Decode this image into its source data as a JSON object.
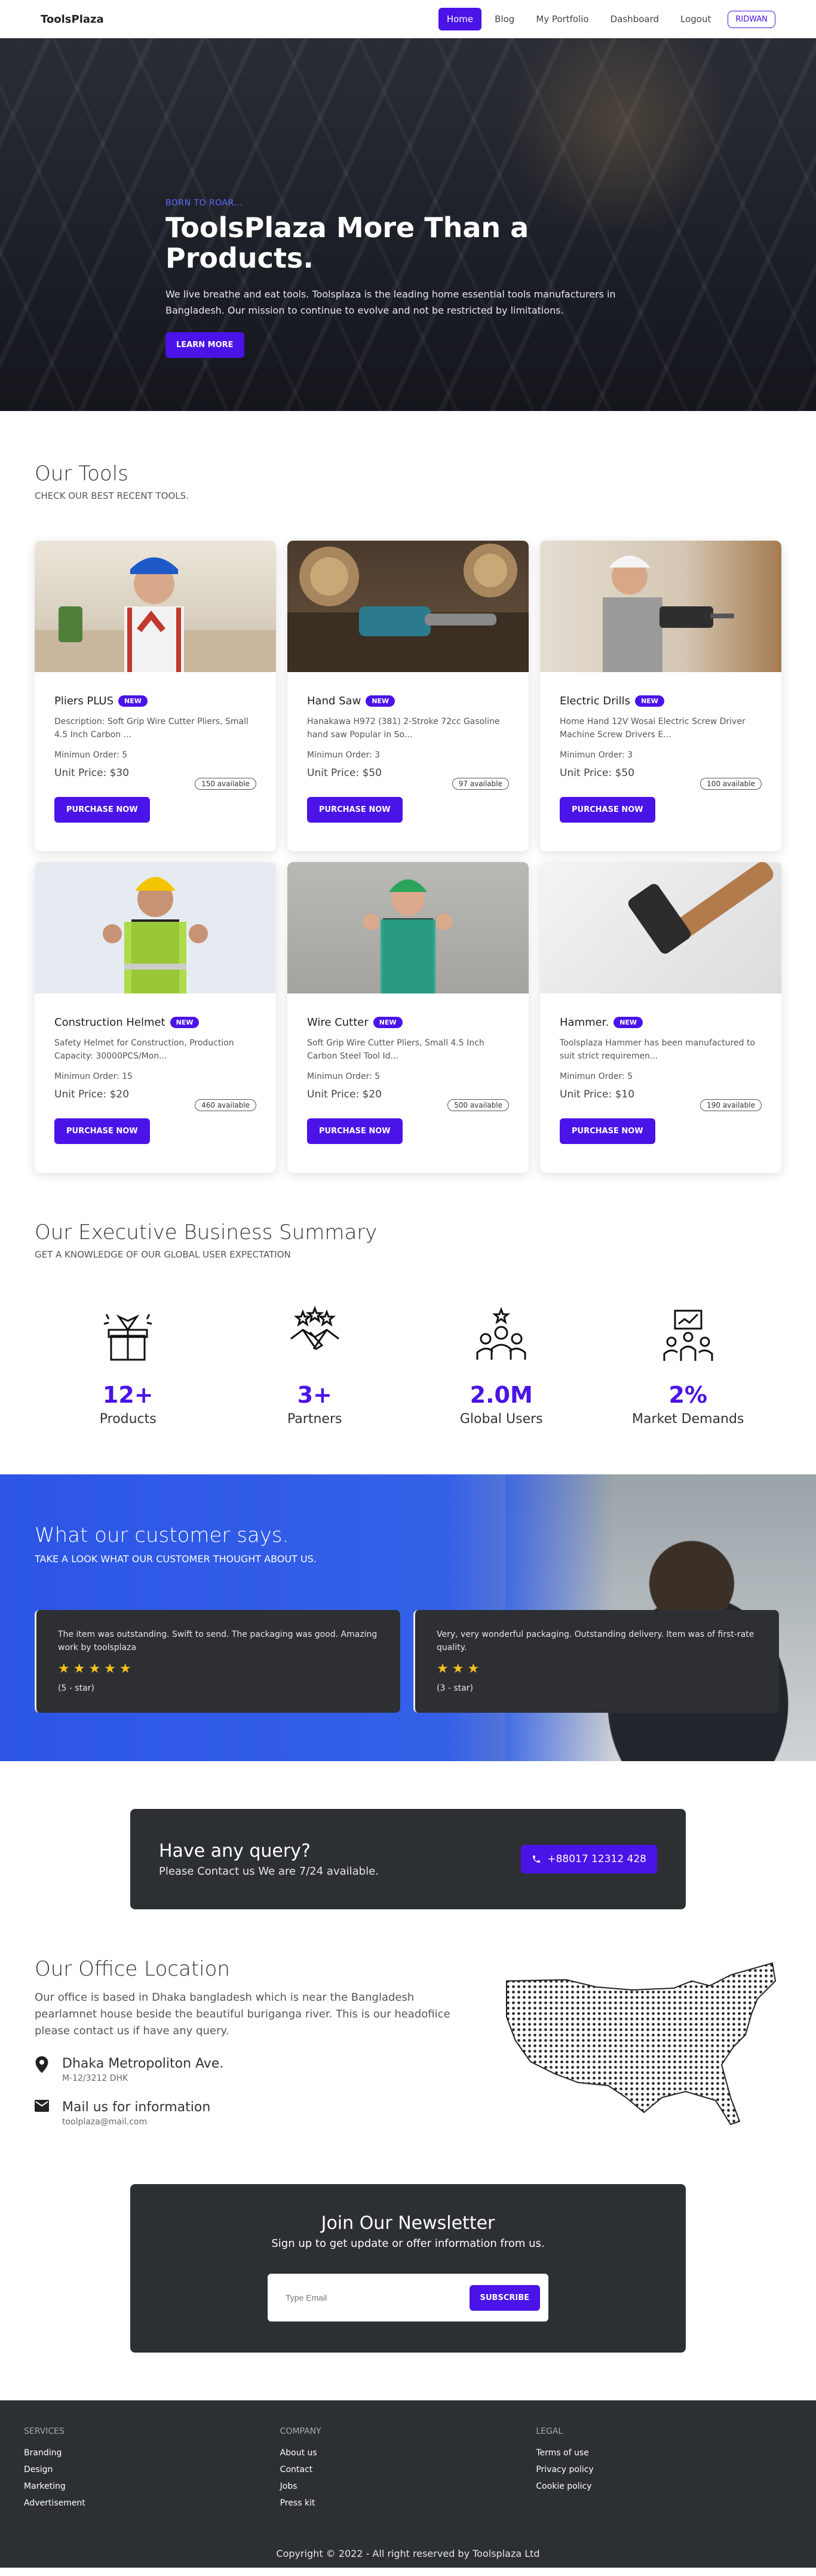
{
  "nav": {
    "brand": "ToolsPlaza",
    "links": [
      "Home",
      "Blog",
      "My Portfolio",
      "Dashboard",
      "Logout"
    ],
    "user": "RIDWAN",
    "accent": "#4a13e7"
  },
  "hero": {
    "kicker": "BORN TO ROAR...",
    "title": "ToolsPlaza More Than a Products.",
    "text": "We live breathe and eat tools. Toolsplaza is the leading home essential tools manufacturers in Bangladesh. Our mission to continue to evolve and not be restricted by limitations.",
    "button": "LEARN MORE"
  },
  "tools": {
    "title": "Our Tools",
    "subtitle": "CHECK OUR BEST RECENT TOOLS.",
    "items": [
      {
        "name": "Pliers PLUS",
        "badge": "NEW",
        "desc": "Description: Soft Grip Wire Cutter Pliers, Small 4.5 Inch Carbon ...",
        "min": "Minimun Order: 5",
        "price": "Unit Price: $30",
        "available": "150 available",
        "button": "PURCHASE NOW"
      },
      {
        "name": "Hand Saw",
        "badge": "NEW",
        "desc": "Hanakawa H972 (381) 2-Stroke 72cc Gasoline hand saw Popular in So...",
        "min": "Minimun Order: 3",
        "price": "Unit Price: $50",
        "available": "97 available",
        "button": "PURCHASE NOW"
      },
      {
        "name": "Electric Drills",
        "badge": "NEW",
        "desc": "Home Hand 12V Wosai Electric Screw Driver Machine Screw Drivers E...",
        "min": "Minimun Order: 3",
        "price": "Unit Price: $50",
        "available": "100 available",
        "button": "PURCHASE NOW"
      },
      {
        "name": "Construction Helmet",
        "badge": "NEW",
        "desc": "Safety Helmet for Construction, Production Capacity: 30000PCS/Mon...",
        "min": "Minimun Order: 15",
        "price": "Unit Price: $20",
        "available": "460 available",
        "button": "PURCHASE NOW"
      },
      {
        "name": "Wire Cutter",
        "badge": "NEW",
        "desc": "Soft Grip Wire Cutter Pliers, Small 4.5 Inch Carbon Steel Tool Id...",
        "min": "Minimun Order: 5",
        "price": "Unit Price: $20",
        "available": "500 available",
        "button": "PURCHASE NOW"
      },
      {
        "name": "Hammer.",
        "badge": "NEW",
        "desc": "Toolsplaza Hammer has been manufactured to suit strict requiremen...",
        "min": "Minimun Order: 5",
        "price": "Unit Price: $10",
        "available": "190 available",
        "button": "PURCHASE NOW"
      }
    ]
  },
  "summary": {
    "title": "Our Executive Business Summary",
    "subtitle": "GET A KNOWLEDGE OF OUR GLOBAL USER EXPECTATION",
    "stats": [
      {
        "value": "12+",
        "label": "Products",
        "icon": "gift-box-icon"
      },
      {
        "value": "3+",
        "label": "Partners",
        "icon": "handshake-icon"
      },
      {
        "value": "2.0M",
        "label": "Global Users",
        "icon": "users-icon"
      },
      {
        "value": "2%",
        "label": "Market Demands",
        "icon": "presentation-icon"
      }
    ]
  },
  "testimonials": {
    "title": "What our customer says.",
    "subtitle": "TAKE A LOOK WHAT OUR CUSTOMER THOUGHT ABOUT US.",
    "reviews": [
      {
        "text": "The item was outstanding. Swift to send. The packaging was good. Amazing work by toolsplaza",
        "stars": "★★★★★",
        "rating": "(5 - star)"
      },
      {
        "text": "Very, very wonderful packaging. Outstanding delivery. Item was of first-rate quality.",
        "stars": "★★★",
        "rating": "(3 - star)"
      }
    ]
  },
  "query": {
    "title": "Have any query?",
    "subtitle": "Please Contact us We are 7/24 available.",
    "phone": "+88017 12312 428"
  },
  "office": {
    "title": "Our Office Location",
    "text": "Our office is based in Dhaka bangladesh which is near the Bangladesh pearlamnet house beside the beautiful buriganga river. This is our headofiice please contact us if have any query.",
    "address_title": "Dhaka Metropoliton Ave.",
    "address_sub": "M-12/3212 DHK",
    "mail_title": "Mail us for information",
    "mail_sub": "toolplaza@mail.com"
  },
  "newsletter": {
    "title": "Join Our Newsletter",
    "subtitle": "Sign up to get update or offer information from us.",
    "placeholder": "Type Email",
    "button": "SUBSCRIBE"
  },
  "footer": {
    "columns": [
      {
        "head": "SERVICES",
        "items": [
          "Branding",
          "Design",
          "Marketing",
          "Advertisement"
        ]
      },
      {
        "head": "COMPANY",
        "items": [
          "About us",
          "Contact",
          "Jobs",
          "Press kit"
        ]
      },
      {
        "head": "LEGAL",
        "items": [
          "Terms of use",
          "Privacy policy",
          "Cookie policy"
        ]
      }
    ],
    "copyright": "Copyright © 2022 - All right reserved by Toolsplaza Ltd"
  }
}
